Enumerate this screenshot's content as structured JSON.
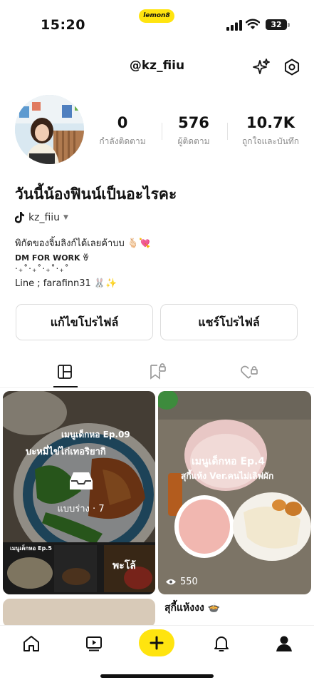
{
  "status_bar": {
    "time": "15:20",
    "app_badge": "lemon8",
    "battery": "32"
  },
  "header": {
    "handle": "@kz_fiiu",
    "icons": [
      "sparkles-icon",
      "settings-icon"
    ]
  },
  "stats": [
    {
      "value": "0",
      "label": "กำลังติดตาม"
    },
    {
      "value": "576",
      "label": "ผู้ติดตาม"
    },
    {
      "value": "10.7K",
      "label": "ถูกใจและบันทึก"
    }
  ],
  "profile": {
    "display_name": "วันนี้น้องฟินน์เป็นอะไรคะ",
    "tiktok_handle": "kz_fiiu",
    "bio_lines": [
      "พิกัดของจิ้มลิงก์ได้เลยค้าบบ 🫰🏻💘",
      "DM FOR WORK ꈊ",
      "‧₊˚‧₊˚‧₊˚‧₊˚",
      "Line ; farafinn31 🐰✨"
    ]
  },
  "buttons": {
    "edit_profile": "แก้ไขโปรไฟล์",
    "share_profile": "แชร์โปรไฟล์"
  },
  "tabs": [
    "grid-icon",
    "saved-locked-icon",
    "liked-locked-icon"
  ],
  "posts": [
    {
      "overlay_title_1": "เมนูเด็กหอ Ep.09",
      "overlay_title_2": "บะหมี่ไข่ไก่เทอริยากิ",
      "drafts_label": "แบบร่าง",
      "drafts_count": "7",
      "thumb_caption_1": "เมนูเด็กหอ Ep.5",
      "thumb_caption_2": "พะโล้"
    },
    {
      "overlay_title_1": "เมนูเด็กหอ Ep.4",
      "overlay_title_2": "สุกี้แห้ง Ver.คนไม่เลิฟผัก",
      "views": "550",
      "title": "สุกี้แห้งงง 🍲"
    }
  ],
  "bottom_nav": [
    "home-icon",
    "video-icon",
    "create-icon",
    "notifications-icon",
    "profile-icon"
  ]
}
